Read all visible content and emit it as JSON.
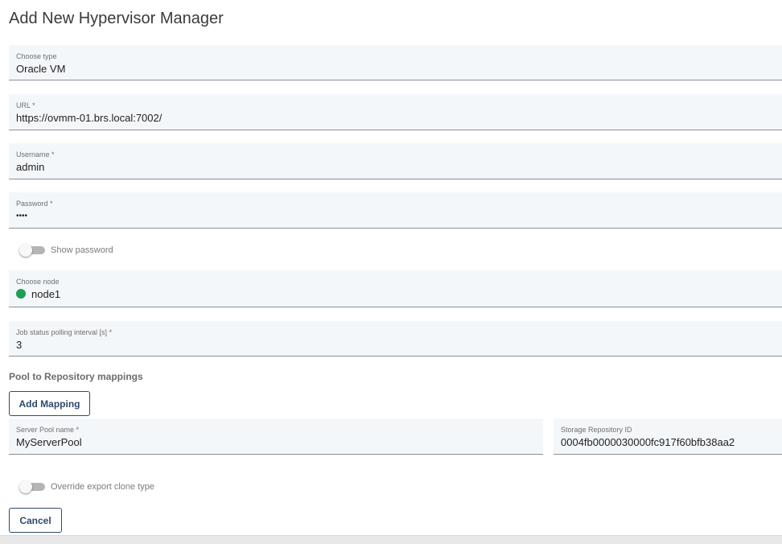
{
  "page": {
    "title": "Add New Hypervisor Manager"
  },
  "form": {
    "type": {
      "label": "Choose type",
      "value": "Oracle VM"
    },
    "url": {
      "label": "URL *",
      "value": "https://ovmm-01.brs.local:7002/"
    },
    "username": {
      "label": "Username *",
      "value": "admin"
    },
    "password": {
      "label": "Password *",
      "value": "••••"
    },
    "show_password": {
      "label": "Show password",
      "checked": false
    },
    "node": {
      "label": "Choose node",
      "value": "node1",
      "status_color": "#1f9d55"
    },
    "polling": {
      "label": "Job status polling interval [s] *",
      "value": "3"
    }
  },
  "mappings": {
    "section_title": "Pool to Repository mappings",
    "add_button": "Add Mapping",
    "server_pool": {
      "label": "Server Pool name *",
      "value": "MyServerPool"
    },
    "storage_repo": {
      "label": "Storage Repository ID",
      "value": "0004fb0000030000fc917f60bfb38aa2"
    },
    "override": {
      "label": "Override export clone type",
      "checked": false
    }
  },
  "actions": {
    "cancel": "Cancel"
  },
  "colors": {
    "field_bg": "#f4f7fa",
    "accent": "#2e4a6b",
    "status_online": "#1f9d55"
  }
}
